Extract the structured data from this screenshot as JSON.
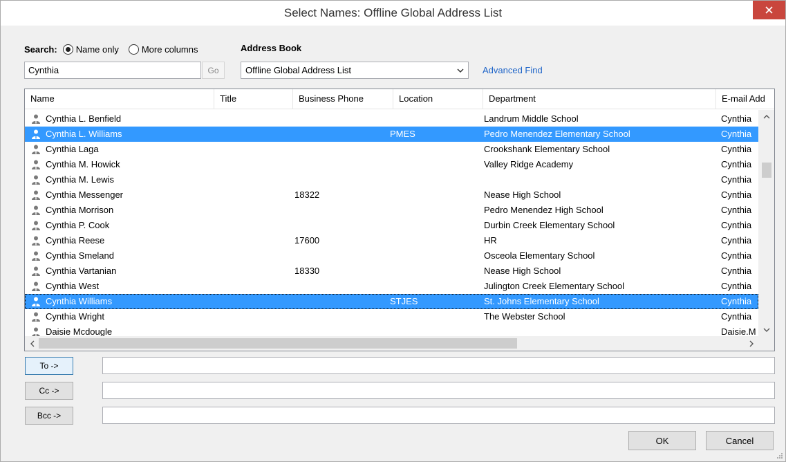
{
  "window": {
    "title": "Select Names: Offline Global Address List"
  },
  "search": {
    "label": "Search:",
    "option_name_only": "Name only",
    "option_more_columns": "More columns",
    "value": "Cynthia",
    "go_label": "Go"
  },
  "address_book": {
    "label": "Address Book",
    "selected": "Offline Global Address List",
    "advanced_find": "Advanced Find"
  },
  "columns": [
    "Name",
    "Title",
    "Business Phone",
    "Location",
    "Department",
    "E-mail Add"
  ],
  "rows": [
    {
      "name": "Cynthia L. Benfield",
      "title": "",
      "phone": "",
      "location": "",
      "department": "Landrum Middle School",
      "email": "Cynthia"
    },
    {
      "name": "Cynthia L. Williams",
      "title": "",
      "phone": "",
      "location": "PMES",
      "department": "Pedro Menendez Elementary School",
      "email": "Cynthia"
    },
    {
      "name": "Cynthia Laga",
      "title": "",
      "phone": "",
      "location": "",
      "department": "Crookshank Elementary School",
      "email": "Cynthia"
    },
    {
      "name": "Cynthia M. Howick",
      "title": "",
      "phone": "",
      "location": "",
      "department": "Valley Ridge Academy",
      "email": "Cynthia"
    },
    {
      "name": "Cynthia M. Lewis",
      "title": "",
      "phone": "",
      "location": "",
      "department": "",
      "email": "Cynthia"
    },
    {
      "name": "Cynthia Messenger",
      "title": "",
      "phone": "18322",
      "location": "",
      "department": "Nease High School",
      "email": "Cynthia"
    },
    {
      "name": "Cynthia Morrison",
      "title": "",
      "phone": "",
      "location": "",
      "department": "Pedro Menendez High School",
      "email": "Cynthia"
    },
    {
      "name": "Cynthia P. Cook",
      "title": "",
      "phone": "",
      "location": "",
      "department": "Durbin Creek Elementary School",
      "email": "Cynthia"
    },
    {
      "name": "Cynthia Reese",
      "title": "",
      "phone": "17600",
      "location": "",
      "department": "HR",
      "email": "Cynthia"
    },
    {
      "name": "Cynthia Smeland",
      "title": "",
      "phone": "",
      "location": "",
      "department": "Osceola Elementary School",
      "email": "Cynthia"
    },
    {
      "name": "Cynthia Vartanian",
      "title": "",
      "phone": "18330",
      "location": "",
      "department": "Nease High School",
      "email": "Cynthia"
    },
    {
      "name": "Cynthia West",
      "title": "",
      "phone": "",
      "location": "",
      "department": "Julington Creek Elementary School",
      "email": "Cynthia"
    },
    {
      "name": "Cynthia Williams",
      "title": "",
      "phone": "",
      "location": "STJES",
      "department": "St. Johns Elementary School",
      "email": "Cynthia"
    },
    {
      "name": "Cynthia Wright",
      "title": "",
      "phone": "",
      "location": "",
      "department": "The Webster School",
      "email": "Cynthia"
    },
    {
      "name": "Daisie Mcdougle",
      "title": "",
      "phone": "",
      "location": "",
      "department": "",
      "email": "Daisie.M"
    }
  ],
  "selected_rows": [
    1,
    12
  ],
  "focused_row": 12,
  "recipients": {
    "to_label": "To ->",
    "cc_label": "Cc ->",
    "bcc_label": "Bcc ->",
    "to_value": "",
    "cc_value": "",
    "bcc_value": ""
  },
  "buttons": {
    "ok": "OK",
    "cancel": "Cancel"
  },
  "colors": {
    "selection": "#3399ff",
    "link": "#1e64c8",
    "close": "#c9463d"
  }
}
